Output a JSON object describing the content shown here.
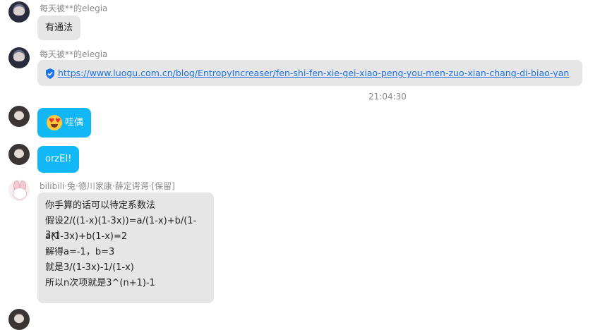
{
  "messages": [
    {
      "sender": "每天被**的elegia",
      "text": "有通法"
    },
    {
      "sender": "每天被**的elegia",
      "link": "https://www.luogu.com.cn/blog/EntropyIncreaser/fen-shi-fen-xie-gei-xiao-peng-you-men-zuo-xian-chang-di-biao-yan"
    },
    {
      "timestamp": "21:04:30"
    },
    {
      "text": "哇偶",
      "emoji": "heart-eyes"
    },
    {
      "text": "orzEI!"
    },
    {
      "sender": "bilibili·兔·德川家康·薛定谔谔·[保留]",
      "lines": [
        "你手算的话可以待定系数法",
        "假设2/((1-x)(1-3x))=a/(1-x)+b/(1-3x)",
        "a(1-3x)+b(1-x)=2",
        "解得a=-1，b=3",
        "就是3/(1-3x)-1/(1-x)",
        "所以n次项就是3^(n+1)-1"
      ]
    }
  ],
  "colors": {
    "sent_bubble": "#12b7f5",
    "received_bubble": "#e6e6e6"
  }
}
